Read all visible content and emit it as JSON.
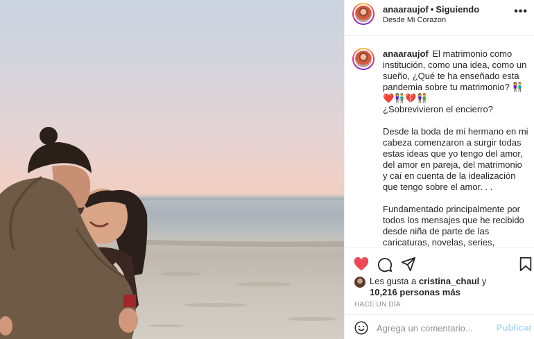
{
  "post": {
    "photo_alt": "",
    "author": {
      "username": "anaaraujof",
      "follow_state": "Siguiendo",
      "location": "Desde Mi Corazon"
    },
    "caption": {
      "username": "anaaraujof",
      "text": "El matrimonio como institución, como una idea, como un sueño, ¿Qué te ha enseñado esta pandemia sobre tu matrimonio? 👫❤️👫💔👫\n¿Sobrevivieron el encierro?\n\nDesde la boda de mi hermano en mi cabeza comenzaron a surgir todas estas ideas que yo tengo del amor, del amor en pareja, del matrimonio y caí en cuenta de la idealización que tengo sobre el amor. . .\n\nFundamentado principalmente por todos los mensajes que he recibido desde niña de parte de las caricaturas, novelas, series, revistas, libros, películas, la"
    },
    "likes": {
      "prefix": "Les gusta a",
      "first_user": "cristina_chaul",
      "joiner": "y",
      "others": "10,216 personas más"
    },
    "timestamp": "HACE UN DÍA",
    "comment": {
      "placeholder": "Agrega un comentario...",
      "publish_label": "Publicar"
    }
  },
  "icons": {
    "more": "more-options-icon",
    "like": "heart-filled-icon",
    "comment": "comment-bubble-icon",
    "share": "paper-plane-icon",
    "save": "bookmark-icon",
    "emoji": "smiley-icon"
  },
  "colors": {
    "like_red": "#ed4956",
    "text": "#262626",
    "muted": "#8e8e8e",
    "publish_disabled": "#b3dbff",
    "border": "#efefef"
  }
}
